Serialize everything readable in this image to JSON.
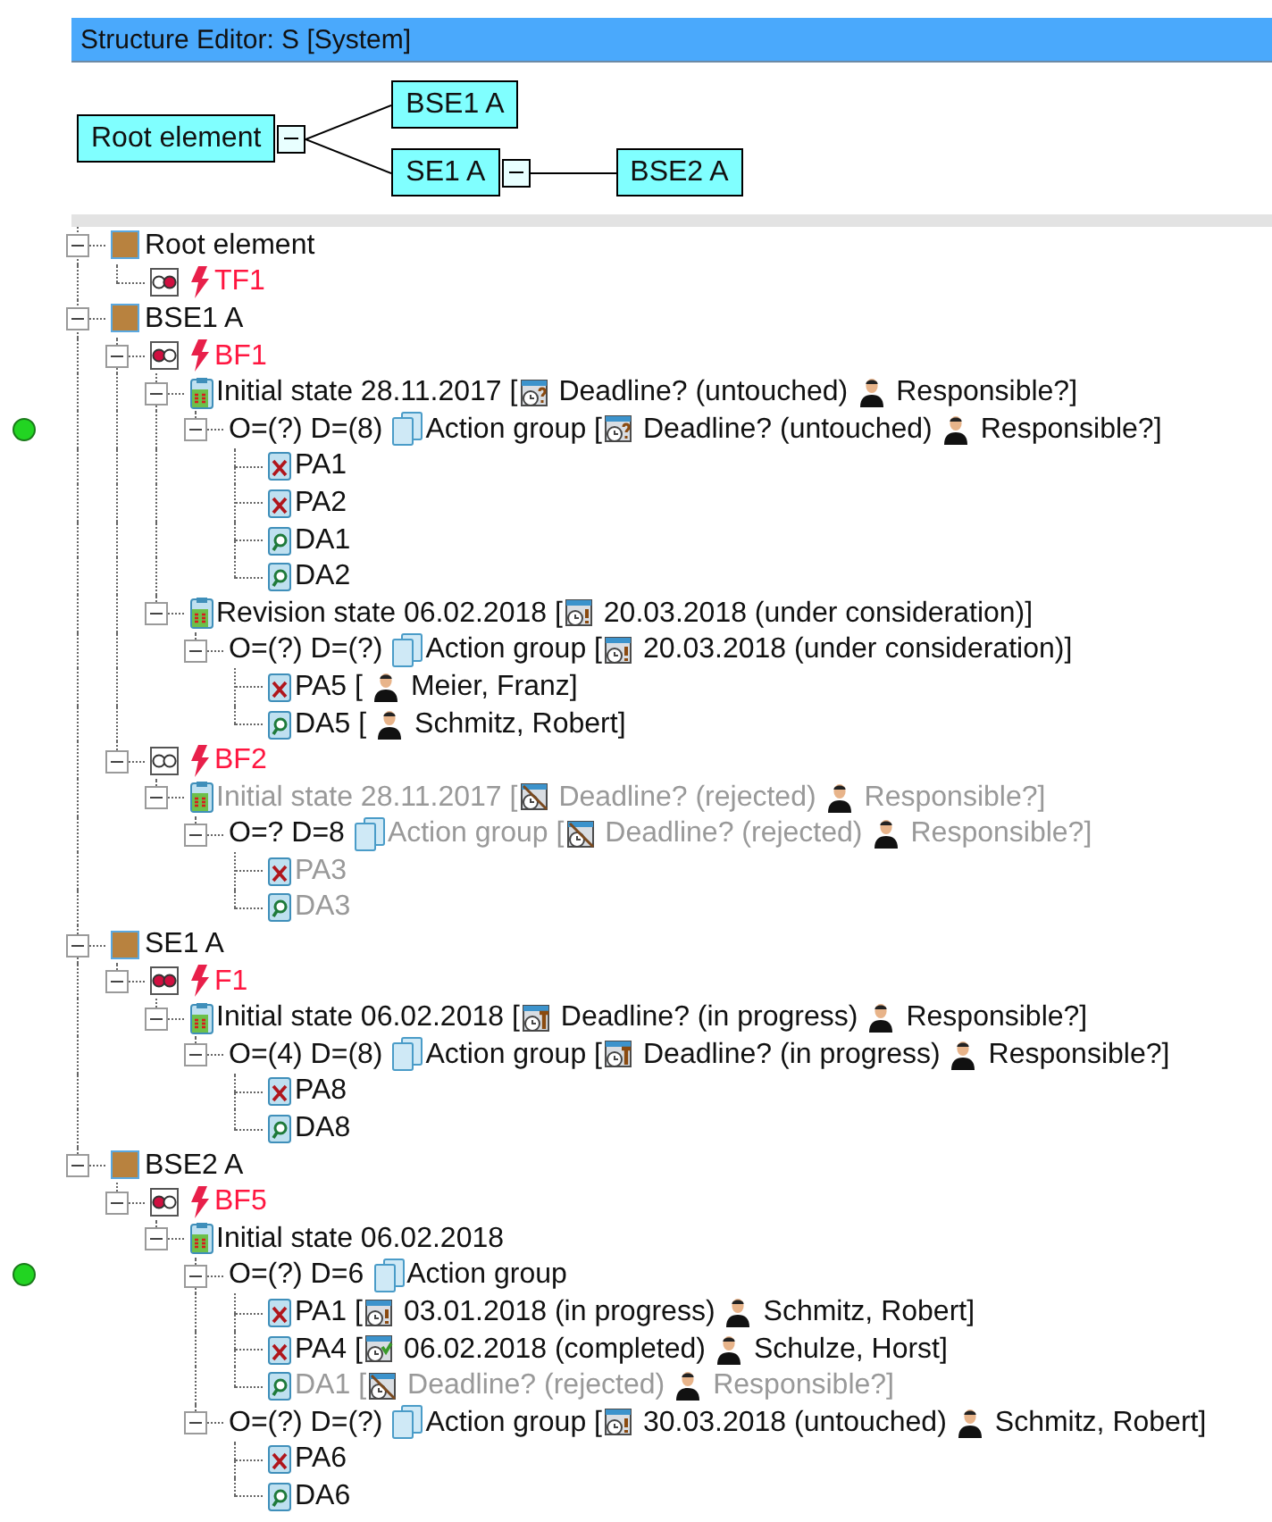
{
  "window": {
    "title": "Structure Editor: S [System]"
  },
  "diagram": {
    "label": "Root element",
    "expanded": true,
    "children": [
      {
        "label": "BSE1 A"
      },
      {
        "label": "SE1 A",
        "expanded": true,
        "children": [
          {
            "label": "BSE2 A"
          }
        ]
      }
    ]
  },
  "tree": [
    {
      "marked": false,
      "expanded": true,
      "parts": [
        {
          "kind": "element"
        },
        {
          "kind": "text",
          "text": "Root element"
        }
      ],
      "children": [
        {
          "marked": false,
          "parts": [
            {
              "kind": "detector",
              "left_on": false,
              "right_on": true
            },
            {
              "kind": "bolt"
            },
            {
              "kind": "alarm",
              "text": "TF1"
            }
          ]
        }
      ]
    },
    {
      "marked": false,
      "expanded": true,
      "parts": [
        {
          "kind": "element"
        },
        {
          "kind": "text",
          "text": "BSE1 A"
        }
      ],
      "children": [
        {
          "marked": false,
          "expanded": true,
          "parts": [
            {
              "kind": "detector",
              "left_on": true,
              "right_on": false
            },
            {
              "kind": "bolt"
            },
            {
              "kind": "alarm",
              "text": "BF1"
            }
          ],
          "children": [
            {
              "marked": false,
              "expanded": true,
              "parts": [
                {
                  "kind": "state"
                },
                {
                  "kind": "text",
                  "text": "Initial state 28.11.2017 ["
                },
                {
                  "kind": "pending"
                },
                {
                  "kind": "text",
                  "text": "Deadline? (untouched)"
                },
                {
                  "kind": "person"
                },
                {
                  "kind": "text",
                  "text": "Responsible?]"
                }
              ],
              "children": [
                {
                  "marked": true,
                  "expanded": true,
                  "parts": [
                    {
                      "kind": "text",
                      "text": "O=(?) D=(8)"
                    },
                    {
                      "kind": "group"
                    },
                    {
                      "kind": "text",
                      "text": "Action group ["
                    },
                    {
                      "kind": "pending"
                    },
                    {
                      "kind": "text",
                      "text": "Deadline? (untouched)"
                    },
                    {
                      "kind": "person"
                    },
                    {
                      "kind": "text",
                      "text": "Responsible?]"
                    }
                  ],
                  "children": [
                    {
                      "marked": false,
                      "parts": [
                        {
                          "kind": "ptask"
                        },
                        {
                          "kind": "text",
                          "text": "PA1"
                        }
                      ]
                    },
                    {
                      "marked": false,
                      "parts": [
                        {
                          "kind": "ptask"
                        },
                        {
                          "kind": "text",
                          "text": "PA2"
                        }
                      ]
                    },
                    {
                      "marked": false,
                      "parts": [
                        {
                          "kind": "dtask"
                        },
                        {
                          "kind": "text",
                          "text": "DA1"
                        }
                      ]
                    },
                    {
                      "marked": false,
                      "parts": [
                        {
                          "kind": "dtask"
                        },
                        {
                          "kind": "text",
                          "text": "DA2"
                        }
                      ]
                    }
                  ]
                }
              ]
            },
            {
              "marked": false,
              "expanded": true,
              "parts": [
                {
                  "kind": "state"
                },
                {
                  "kind": "text",
                  "text": "Revision state 06.02.2018 ["
                },
                {
                  "kind": "alert"
                },
                {
                  "kind": "text",
                  "text": "20.03.2018 (under consideration)]"
                }
              ],
              "children": [
                {
                  "marked": false,
                  "expanded": true,
                  "parts": [
                    {
                      "kind": "text",
                      "text": "O=(?) D=(?)"
                    },
                    {
                      "kind": "group"
                    },
                    {
                      "kind": "text",
                      "text": "Action group ["
                    },
                    {
                      "kind": "alert"
                    },
                    {
                      "kind": "text",
                      "text": "20.03.2018 (under consideration)]"
                    }
                  ],
                  "children": [
                    {
                      "marked": false,
                      "parts": [
                        {
                          "kind": "ptask"
                        },
                        {
                          "kind": "text",
                          "text": "PA5 ["
                        },
                        {
                          "kind": "person"
                        },
                        {
                          "kind": "text",
                          "text": "Meier, Franz]"
                        }
                      ]
                    },
                    {
                      "marked": false,
                      "parts": [
                        {
                          "kind": "dtask"
                        },
                        {
                          "kind": "text",
                          "text": "DA5 ["
                        },
                        {
                          "kind": "person"
                        },
                        {
                          "kind": "text",
                          "text": "Schmitz, Robert]"
                        }
                      ]
                    }
                  ]
                }
              ]
            }
          ]
        },
        {
          "marked": false,
          "expanded": true,
          "parts": [
            {
              "kind": "detector",
              "left_on": false,
              "right_on": false
            },
            {
              "kind": "bolt"
            },
            {
              "kind": "alarm",
              "text": "BF2"
            }
          ],
          "children": [
            {
              "marked": false,
              "expanded": true,
              "parts": [
                {
                  "kind": "state"
                },
                {
                  "kind": "muted",
                  "text": "Initial state 28.11.2017 ["
                },
                {
                  "kind": "rejected"
                },
                {
                  "kind": "muted",
                  "text": "Deadline? (rejected)"
                },
                {
                  "kind": "person"
                },
                {
                  "kind": "muted",
                  "text": "Responsible?]"
                }
              ],
              "children": [
                {
                  "marked": false,
                  "expanded": true,
                  "parts": [
                    {
                      "kind": "text",
                      "text": "O=? D=8"
                    },
                    {
                      "kind": "group"
                    },
                    {
                      "kind": "muted",
                      "text": "Action group ["
                    },
                    {
                      "kind": "rejected"
                    },
                    {
                      "kind": "muted",
                      "text": "Deadline? (rejected)"
                    },
                    {
                      "kind": "person"
                    },
                    {
                      "kind": "muted",
                      "text": "Responsible?]"
                    }
                  ],
                  "children": [
                    {
                      "marked": false,
                      "parts": [
                        {
                          "kind": "ptask"
                        },
                        {
                          "kind": "muted",
                          "text": "PA3"
                        }
                      ]
                    },
                    {
                      "marked": false,
                      "parts": [
                        {
                          "kind": "dtask"
                        },
                        {
                          "kind": "muted",
                          "text": "DA3"
                        }
                      ]
                    }
                  ]
                }
              ]
            }
          ]
        }
      ]
    },
    {
      "marked": false,
      "expanded": true,
      "parts": [
        {
          "kind": "element"
        },
        {
          "kind": "text",
          "text": "SE1 A"
        }
      ],
      "children": [
        {
          "marked": false,
          "expanded": true,
          "parts": [
            {
              "kind": "detector",
              "left_on": true,
              "right_on": true
            },
            {
              "kind": "bolt"
            },
            {
              "kind": "alarm",
              "text": "F1"
            }
          ],
          "children": [
            {
              "marked": false,
              "expanded": true,
              "parts": [
                {
                  "kind": "state"
                },
                {
                  "kind": "text",
                  "text": "Initial state 06.02.2018 ["
                },
                {
                  "kind": "working"
                },
                {
                  "kind": "text",
                  "text": "Deadline? (in progress)"
                },
                {
                  "kind": "person"
                },
                {
                  "kind": "text",
                  "text": "Responsible?]"
                }
              ],
              "children": [
                {
                  "marked": false,
                  "expanded": true,
                  "parts": [
                    {
                      "kind": "text",
                      "text": "O=(4) D=(8)"
                    },
                    {
                      "kind": "group"
                    },
                    {
                      "kind": "text",
                      "text": "Action group ["
                    },
                    {
                      "kind": "working"
                    },
                    {
                      "kind": "text",
                      "text": "Deadline? (in progress)"
                    },
                    {
                      "kind": "person"
                    },
                    {
                      "kind": "text",
                      "text": "Responsible?]"
                    }
                  ],
                  "children": [
                    {
                      "marked": false,
                      "parts": [
                        {
                          "kind": "ptask"
                        },
                        {
                          "kind": "text",
                          "text": "PA8"
                        }
                      ]
                    },
                    {
                      "marked": false,
                      "parts": [
                        {
                          "kind": "dtask"
                        },
                        {
                          "kind": "text",
                          "text": "DA8"
                        }
                      ]
                    }
                  ]
                }
              ]
            }
          ]
        }
      ]
    },
    {
      "marked": false,
      "expanded": true,
      "parts": [
        {
          "kind": "element"
        },
        {
          "kind": "text",
          "text": "BSE2 A"
        }
      ],
      "children": [
        {
          "marked": false,
          "expanded": true,
          "parts": [
            {
              "kind": "detector",
              "left_on": true,
              "right_on": false
            },
            {
              "kind": "bolt"
            },
            {
              "kind": "alarm",
              "text": "BF5"
            }
          ],
          "children": [
            {
              "marked": false,
              "expanded": true,
              "parts": [
                {
                  "kind": "state"
                },
                {
                  "kind": "text",
                  "text": "Initial state 06.02.2018"
                }
              ],
              "children": [
                {
                  "marked": true,
                  "expanded": true,
                  "parts": [
                    {
                      "kind": "text",
                      "text": "O=(?) D=6"
                    },
                    {
                      "kind": "group"
                    },
                    {
                      "kind": "text",
                      "text": "Action group"
                    }
                  ],
                  "children": [
                    {
                      "marked": false,
                      "parts": [
                        {
                          "kind": "ptask"
                        },
                        {
                          "kind": "text",
                          "text": "PA1 ["
                        },
                        {
                          "kind": "alert"
                        },
                        {
                          "kind": "text",
                          "text": "03.01.2018 (in progress)"
                        },
                        {
                          "kind": "person"
                        },
                        {
                          "kind": "text",
                          "text": "Schmitz, Robert]"
                        }
                      ]
                    },
                    {
                      "marked": false,
                      "parts": [
                        {
                          "kind": "ptask"
                        },
                        {
                          "kind": "text",
                          "text": "PA4 ["
                        },
                        {
                          "kind": "done"
                        },
                        {
                          "kind": "text",
                          "text": "06.02.2018 (completed)"
                        },
                        {
                          "kind": "person"
                        },
                        {
                          "kind": "text",
                          "text": "Schulze, Horst]"
                        }
                      ]
                    },
                    {
                      "marked": false,
                      "parts": [
                        {
                          "kind": "dtask"
                        },
                        {
                          "kind": "muted",
                          "text": "DA1 ["
                        },
                        {
                          "kind": "rejected"
                        },
                        {
                          "kind": "muted",
                          "text": "Deadline? (rejected)"
                        },
                        {
                          "kind": "person"
                        },
                        {
                          "kind": "muted",
                          "text": "Responsible?]"
                        }
                      ]
                    }
                  ]
                },
                {
                  "marked": false,
                  "expanded": true,
                  "parts": [
                    {
                      "kind": "text",
                      "text": "O=(?) D=(?)"
                    },
                    {
                      "kind": "group"
                    },
                    {
                      "kind": "text",
                      "text": "Action group ["
                    },
                    {
                      "kind": "alert"
                    },
                    {
                      "kind": "text",
                      "text": "30.03.2018 (untouched)"
                    },
                    {
                      "kind": "person"
                    },
                    {
                      "kind": "text",
                      "text": "Schmitz, Robert]"
                    }
                  ],
                  "children": [
                    {
                      "marked": false,
                      "parts": [
                        {
                          "kind": "ptask"
                        },
                        {
                          "kind": "text",
                          "text": "PA6"
                        }
                      ]
                    },
                    {
                      "marked": false,
                      "parts": [
                        {
                          "kind": "dtask"
                        },
                        {
                          "kind": "text",
                          "text": "DA6"
                        }
                      ]
                    }
                  ]
                }
              ]
            }
          ]
        }
      ]
    }
  ]
}
